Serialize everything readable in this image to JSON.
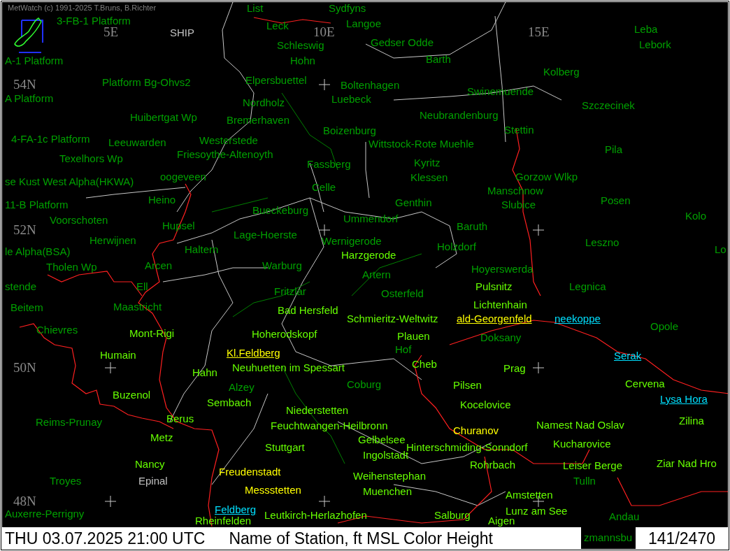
{
  "credit": "MetWatch  (c) 1991-2025 T.Bruns, B.Richter",
  "map_label": "SHIP",
  "grid_labels": [
    "5E",
    "10E",
    "15E",
    "54N",
    "52N",
    "50N",
    "48N"
  ],
  "stations": [
    {
      "name": "List",
      "color": "#00a000",
      "underlined": false
    },
    {
      "name": "Sydfyns",
      "color": "#00a000",
      "underlined": false
    },
    {
      "name": "3-FB-1 Platform",
      "color": "#00a000",
      "underlined": false
    },
    {
      "name": "Leck",
      "color": "#00a000",
      "underlined": false
    },
    {
      "name": "Langoe",
      "color": "#00a000",
      "underlined": false
    },
    {
      "name": "Leba",
      "color": "#00a000",
      "underlined": false
    },
    {
      "name": "Schleswig",
      "color": "#00a000",
      "underlined": false
    },
    {
      "name": "Gedser Odde",
      "color": "#00a000",
      "underlined": false
    },
    {
      "name": "Lebork",
      "color": "#00a000",
      "underlined": false
    },
    {
      "name": "A-1 Platform",
      "color": "#00a000",
      "underlined": false
    },
    {
      "name": "Hohn",
      "color": "#00a000",
      "underlined": false
    },
    {
      "name": "Barth",
      "color": "#00a000",
      "underlined": false
    },
    {
      "name": "Kolberg",
      "color": "#00a000",
      "underlined": false
    },
    {
      "name": "Platform Bg-Ohvs2",
      "color": "#00a000",
      "underlined": false
    },
    {
      "name": "Elpersbuettel",
      "color": "#00a000",
      "underlined": false
    },
    {
      "name": "Boltenhagen",
      "color": "#00a000",
      "underlined": false
    },
    {
      "name": "Swinemuende",
      "color": "#00a000",
      "underlined": false
    },
    {
      "name": "A Platform",
      "color": "#00a000",
      "underlined": false
    },
    {
      "name": "Nordholz",
      "color": "#00a000",
      "underlined": false
    },
    {
      "name": "Luebeck",
      "color": "#00a000",
      "underlined": false
    },
    {
      "name": "Szczecinek",
      "color": "#00a000",
      "underlined": false
    },
    {
      "name": "Huibertgat Wp",
      "color": "#00a000",
      "underlined": false
    },
    {
      "name": "Bremerhaven",
      "color": "#00a000",
      "underlined": false
    },
    {
      "name": "Neubrandenburg",
      "color": "#00a000",
      "underlined": false
    },
    {
      "name": "Boizenburg",
      "color": "#00a000",
      "underlined": false
    },
    {
      "name": "Stettin",
      "color": "#00a000",
      "underlined": false
    },
    {
      "name": "4-FA-1c Platform",
      "color": "#00a000",
      "underlined": false
    },
    {
      "name": "Leeuwarden",
      "color": "#00a000",
      "underlined": false
    },
    {
      "name": "Westerstede",
      "color": "#00a000",
      "underlined": false
    },
    {
      "name": "Wittstock-Rote Muehle",
      "color": "#00a000",
      "underlined": false
    },
    {
      "name": "Pila",
      "color": "#00a000",
      "underlined": false
    },
    {
      "name": "Texelhors Wp",
      "color": "#00a000",
      "underlined": false
    },
    {
      "name": "Friesoythe-Altenoyth",
      "color": "#00a000",
      "underlined": false
    },
    {
      "name": "Fassberg",
      "color": "#00a000",
      "underlined": false
    },
    {
      "name": "Kyritz",
      "color": "#00a000",
      "underlined": false
    },
    {
      "name": "se Kust West Alpha(HKWA)",
      "color": "#00a000",
      "underlined": false
    },
    {
      "name": "oogeveen",
      "color": "#00a000",
      "underlined": false
    },
    {
      "name": "Klessen",
      "color": "#00a000",
      "underlined": false
    },
    {
      "name": "Gorzow Wlkp",
      "color": "#00a000",
      "underlined": false
    },
    {
      "name": "Celle",
      "color": "#00a000",
      "underlined": false
    },
    {
      "name": "Manschnow",
      "color": "#00a000",
      "underlined": false
    },
    {
      "name": "11-B Platform",
      "color": "#00a000",
      "underlined": false
    },
    {
      "name": "Heino",
      "color": "#00a000",
      "underlined": false
    },
    {
      "name": "Genthin",
      "color": "#00a000",
      "underlined": false
    },
    {
      "name": "Slubice",
      "color": "#00a000",
      "underlined": false
    },
    {
      "name": "Posen",
      "color": "#00a000",
      "underlined": false
    },
    {
      "name": "Bueckeburg",
      "color": "#00a000",
      "underlined": false
    },
    {
      "name": "Voorschoten",
      "color": "#00a000",
      "underlined": false
    },
    {
      "name": "Ummendorf",
      "color": "#00a000",
      "underlined": false
    },
    {
      "name": "Kolo",
      "color": "#00a000",
      "underlined": false
    },
    {
      "name": "Hupsel",
      "color": "#00a000",
      "underlined": false
    },
    {
      "name": "Baruth",
      "color": "#00a000",
      "underlined": false
    },
    {
      "name": "Herwijnen",
      "color": "#00a000",
      "underlined": false
    },
    {
      "name": "Lage-Hoerste",
      "color": "#00a000",
      "underlined": false
    },
    {
      "name": "Wernigerode",
      "color": "#00a000",
      "underlined": false
    },
    {
      "name": "Leszno",
      "color": "#00a000",
      "underlined": false
    },
    {
      "name": "le Alpha(BSA)",
      "color": "#00a000",
      "underlined": false
    },
    {
      "name": "Haltern",
      "color": "#00a000",
      "underlined": false
    },
    {
      "name": "Harzgerode",
      "color": "#66ff00",
      "underlined": false
    },
    {
      "name": "Holzdorf",
      "color": "#00a000",
      "underlined": false
    },
    {
      "name": "Lo",
      "color": "#00a000",
      "underlined": false
    },
    {
      "name": "Tholen Wp",
      "color": "#00a000",
      "underlined": false
    },
    {
      "name": "Arcen",
      "color": "#00a000",
      "underlined": false
    },
    {
      "name": "Warburg",
      "color": "#00a000",
      "underlined": false
    },
    {
      "name": "Artern",
      "color": "#00a000",
      "underlined": false
    },
    {
      "name": "Hoyerswerda",
      "color": "#00a000",
      "underlined": false
    },
    {
      "name": "stende",
      "color": "#00a000",
      "underlined": false
    },
    {
      "name": "Ell",
      "color": "#00a000",
      "underlined": false
    },
    {
      "name": "Fritzlar",
      "color": "#00a000",
      "underlined": false
    },
    {
      "name": "Osterfeld",
      "color": "#00a000",
      "underlined": false
    },
    {
      "name": "Pulsnitz",
      "color": "#66ff00",
      "underlined": false
    },
    {
      "name": "Legnica",
      "color": "#00a000",
      "underlined": false
    },
    {
      "name": "Beitem",
      "color": "#00a000",
      "underlined": false
    },
    {
      "name": "Maastricht",
      "color": "#00a000",
      "underlined": false
    },
    {
      "name": "Bad Hersfeld",
      "color": "#66ff00",
      "underlined": false
    },
    {
      "name": "Lichtenhain",
      "color": "#66ff00",
      "underlined": false
    },
    {
      "name": "Schmieritz-Weltwitz",
      "color": "#66ff00",
      "underlined": false
    },
    {
      "name": "ald-Georgenfeld",
      "color": "#ffff00",
      "underlined": true
    },
    {
      "name": "neekoppe",
      "color": "#00e0ff",
      "underlined": true
    },
    {
      "name": "Chievres",
      "color": "#00a000",
      "underlined": false
    },
    {
      "name": "Mont-Rigi",
      "color": "#66ff00",
      "underlined": false
    },
    {
      "name": "Hoherodskopf",
      "color": "#66ff00",
      "underlined": false
    },
    {
      "name": "Plauen",
      "color": "#66ff00",
      "underlined": false
    },
    {
      "name": "Doksany",
      "color": "#00a000",
      "underlined": false
    },
    {
      "name": "Opole",
      "color": "#00a000",
      "underlined": false
    },
    {
      "name": "Hof",
      "color": "#00a000",
      "underlined": false
    },
    {
      "name": "Humain",
      "color": "#66ff00",
      "underlined": false
    },
    {
      "name": "Kl.Feldberg",
      "color": "#ffff00",
      "underlined": true
    },
    {
      "name": "Serak",
      "color": "#00e0ff",
      "underlined": true
    },
    {
      "name": "Hahn",
      "color": "#66ff00",
      "underlined": false
    },
    {
      "name": "Neuhuetten im Spessart",
      "color": "#66ff00",
      "underlined": false
    },
    {
      "name": "Cheb",
      "color": "#66ff00",
      "underlined": false
    },
    {
      "name": "Prag",
      "color": "#66ff00",
      "underlined": false
    },
    {
      "name": "Alzey",
      "color": "#00a000",
      "underlined": false
    },
    {
      "name": "Coburg",
      "color": "#00a000",
      "underlined": false
    },
    {
      "name": "Pilsen",
      "color": "#66ff00",
      "underlined": false
    },
    {
      "name": "Cervena",
      "color": "#66ff00",
      "underlined": false
    },
    {
      "name": "Buzenol",
      "color": "#66ff00",
      "underlined": false
    },
    {
      "name": "Sembach",
      "color": "#66ff00",
      "underlined": false
    },
    {
      "name": "Kocelovice",
      "color": "#66ff00",
      "underlined": false
    },
    {
      "name": "Lysa Hora",
      "color": "#00e0ff",
      "underlined": true
    },
    {
      "name": "Niederstetten",
      "color": "#66ff00",
      "underlined": false
    },
    {
      "name": "Reims-Prunay",
      "color": "#00a000",
      "underlined": false
    },
    {
      "name": "Berus",
      "color": "#66ff00",
      "underlined": false
    },
    {
      "name": "Feuchtwangen-Heilbronn",
      "color": "#66ff00",
      "underlined": false
    },
    {
      "name": "Namest Nad Oslav",
      "color": "#66ff00",
      "underlined": false
    },
    {
      "name": "Zilina",
      "color": "#66ff00",
      "underlined": false
    },
    {
      "name": "Churanov",
      "color": "#ffff00",
      "underlined": false
    },
    {
      "name": "Metz",
      "color": "#66ff00",
      "underlined": false
    },
    {
      "name": "Gelbelsee",
      "color": "#66ff00",
      "underlined": false
    },
    {
      "name": "Stuttgart",
      "color": "#66ff00",
      "underlined": false
    },
    {
      "name": "Hinterschmiding-Sonndorf",
      "color": "#66ff00",
      "underlined": false
    },
    {
      "name": "Kucharovice",
      "color": "#66ff00",
      "underlined": false
    },
    {
      "name": "Ingolstadt",
      "color": "#66ff00",
      "underlined": false
    },
    {
      "name": "Nancy",
      "color": "#66ff00",
      "underlined": false
    },
    {
      "name": "Rohrbach",
      "color": "#66ff00",
      "underlined": false
    },
    {
      "name": "Leiser Berge",
      "color": "#66ff00",
      "underlined": false
    },
    {
      "name": "Ziar Nad Hro",
      "color": "#66ff00",
      "underlined": false
    },
    {
      "name": "Troyes",
      "color": "#00a000",
      "underlined": false
    },
    {
      "name": "Epinal",
      "color": "#c0c0c0",
      "underlined": false
    },
    {
      "name": "Freudenstadt",
      "color": "#ffff00",
      "underlined": false
    },
    {
      "name": "Weihenstephan",
      "color": "#66ff00",
      "underlined": false
    },
    {
      "name": "Tulln",
      "color": "#00a000",
      "underlined": false
    },
    {
      "name": "Messstetten",
      "color": "#ffff00",
      "underlined": false
    },
    {
      "name": "Muenchen",
      "color": "#66ff00",
      "underlined": false
    },
    {
      "name": "Amstetten",
      "color": "#66ff00",
      "underlined": false
    },
    {
      "name": "Auxerre-Perrigny",
      "color": "#00a000",
      "underlined": false
    },
    {
      "name": "Feldberg",
      "color": "#00e0ff",
      "underlined": true
    },
    {
      "name": "Rheinfelden",
      "color": "#66ff00",
      "underlined": false
    },
    {
      "name": "Leutkirch-Herlazhofen",
      "color": "#66ff00",
      "underlined": false
    },
    {
      "name": "Salburg",
      "color": "#66ff00",
      "underlined": false
    },
    {
      "name": "Lunz am See",
      "color": "#66ff00",
      "underlined": false
    },
    {
      "name": "Aigen",
      "color": "#66ff00",
      "underlined": false
    },
    {
      "name": "Andau",
      "color": "#00a000",
      "underlined": false
    },
    {
      "name": "zmannsbu",
      "color": "#00a000",
      "underlined": false
    }
  ],
  "status_bar": {
    "datetime": "THU 03.07.2025 21:00 UTC",
    "legend": "Name of Station,  ft MSL Color Height",
    "count": "141/2470"
  }
}
